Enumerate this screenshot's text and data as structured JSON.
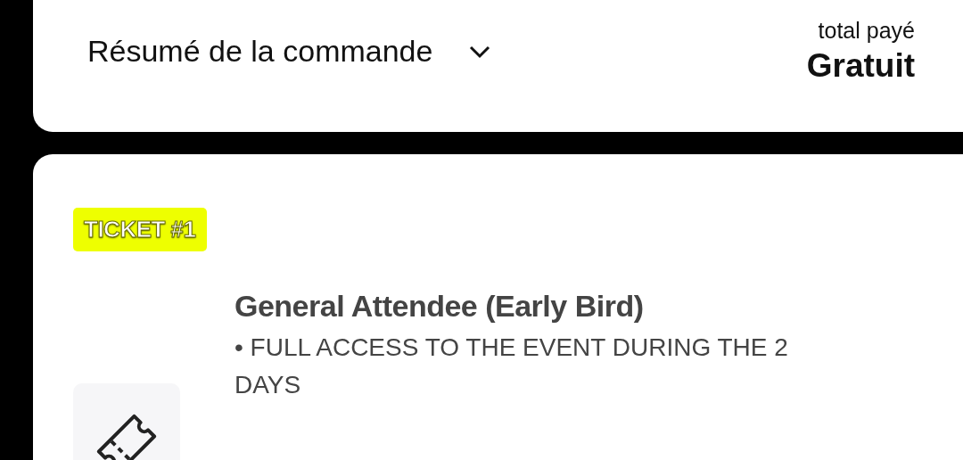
{
  "order_summary": {
    "title": "Résumé de la commande",
    "expanded": false,
    "total_label": "total payé",
    "total_value": "Gratuit"
  },
  "ticket": {
    "badge": "TICKET #1",
    "name": "General Attendee (Early Bird)",
    "description": "• FULL ACCESS TO THE EVENT DURING THE 2 DAYS"
  }
}
